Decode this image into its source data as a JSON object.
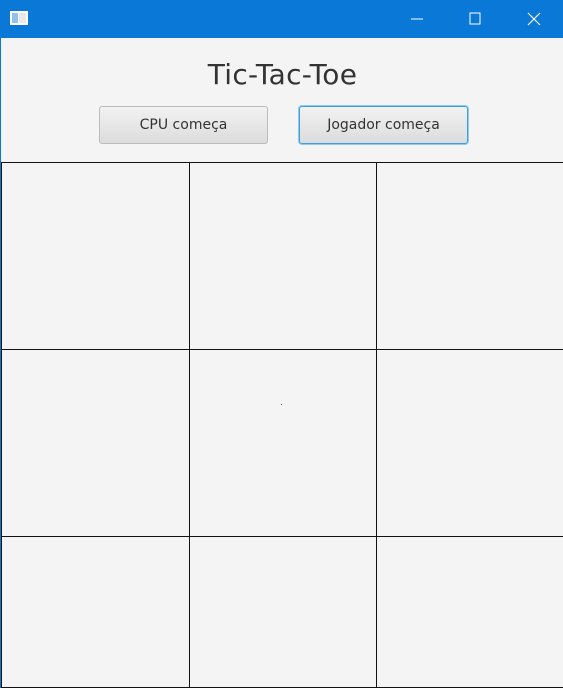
{
  "window": {
    "icon": "app-window-icon",
    "controls": [
      "minimize-icon",
      "maximize-icon",
      "close-icon"
    ],
    "titlebar_color": "#0a78d6"
  },
  "main": {
    "title": "Tic-Tac-Toe",
    "buttons": {
      "cpu_start": "CPU começa",
      "player_start": "Jogador começa"
    }
  },
  "board": {
    "rows": 3,
    "cols": 3,
    "cells": [
      "",
      "",
      "",
      "",
      "",
      "",
      "",
      "",
      ""
    ]
  }
}
